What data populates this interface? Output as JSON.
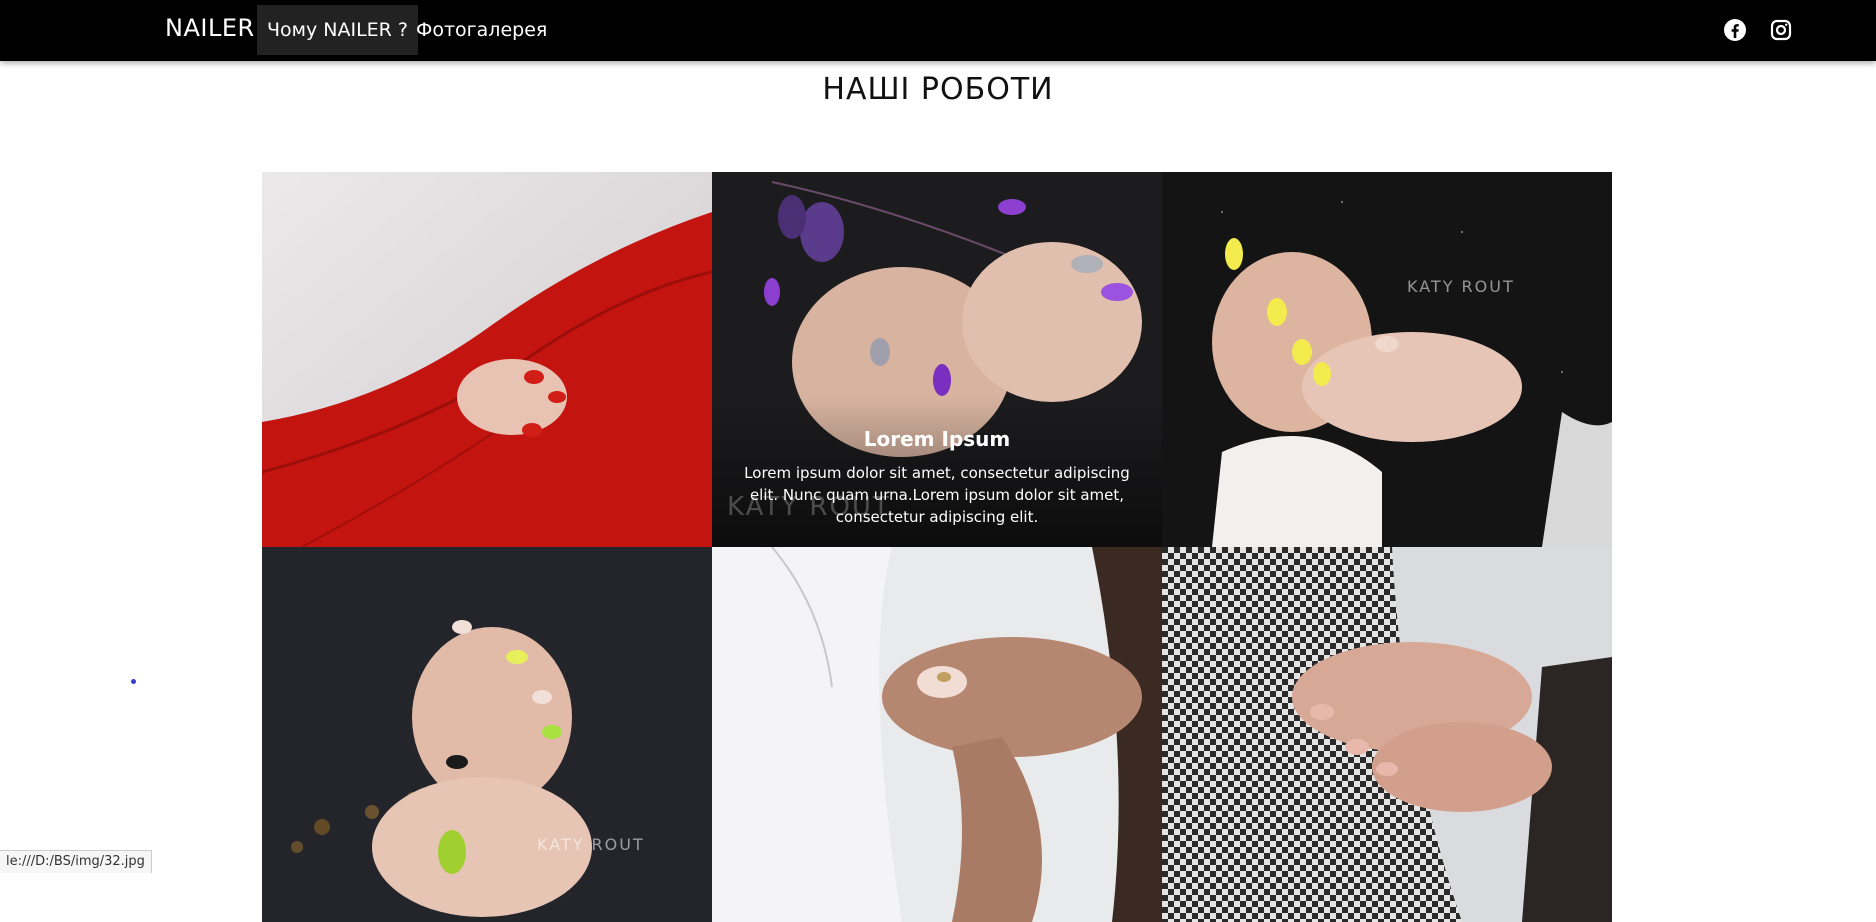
{
  "navbar": {
    "brand": "NAILER",
    "links": [
      {
        "label": "Чому NAILER ?",
        "active": true
      },
      {
        "label": "Фотогалерея",
        "active": false
      }
    ],
    "social_icons": [
      "facebook-icon",
      "instagram-icon"
    ]
  },
  "gallery": {
    "title": "НАШІ РОБОТИ",
    "tiles": [
      {
        "watermark": ""
      },
      {
        "watermark": "KATY ROUT",
        "caption_title": "Lorem Ipsum",
        "caption_text": "Lorem ipsum dolor sit amet, consectetur adipiscing elit. Nunc quam urna.Lorem ipsum dolor sit amet, consectetur adipiscing elit."
      },
      {
        "watermark": "KATY ROUT"
      },
      {
        "watermark": "KATY ROUT"
      },
      {
        "watermark": ""
      },
      {
        "watermark": ""
      }
    ]
  },
  "statusbar": {
    "text": "le:///D:/BS/img/32.jpg"
  },
  "colors": {
    "navbar_bg": "#000000",
    "active_link_bg": "#222222",
    "text": "#111111"
  }
}
